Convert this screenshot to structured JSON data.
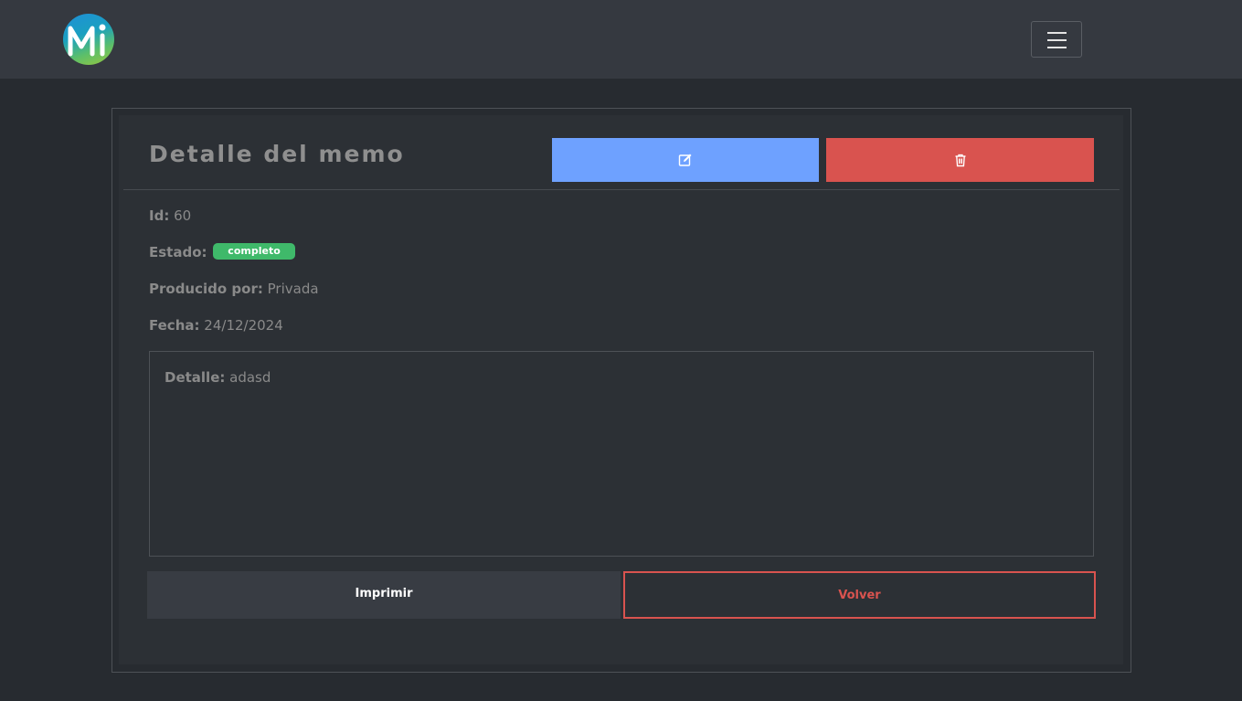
{
  "navbar": {
    "logo_alt": "MI",
    "toggler_icon": "hamburger-menu-icon"
  },
  "card": {
    "title": "Detalle del memo",
    "edit_icon": "edit-icon",
    "delete_icon": "trash-icon"
  },
  "fields": {
    "id": {
      "label": "Id:",
      "value": "60"
    },
    "estado": {
      "label": "Estado:",
      "badge": "completo"
    },
    "producido": {
      "label": "Producido por:",
      "value": "Privada"
    },
    "fecha": {
      "label": "Fecha:",
      "value": "24/12/2024"
    }
  },
  "detalle": {
    "label": "Detalle:",
    "value": "adasd"
  },
  "actions": {
    "print_label": "Imprimir",
    "back_label": "Volver"
  },
  "colors": {
    "edit": "#6ea1ff",
    "delete": "#d9534f",
    "badge": "#3fb96a",
    "background": "#272b30",
    "navbar": "#353940"
  }
}
